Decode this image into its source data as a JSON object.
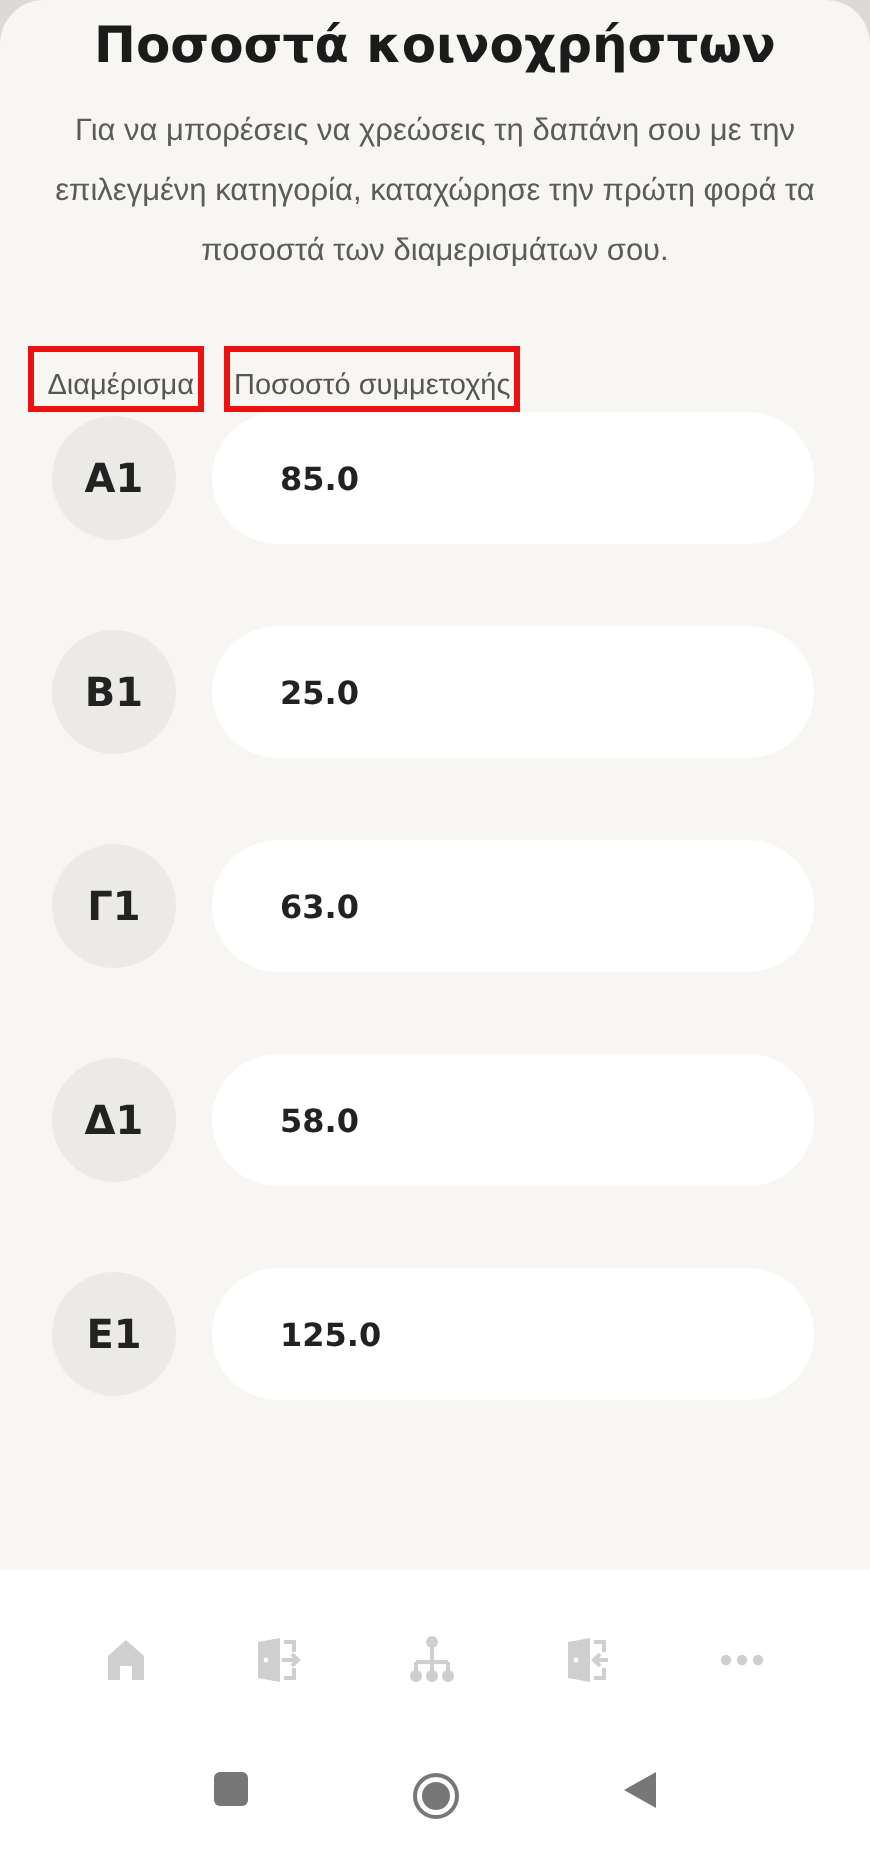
{
  "title": "Ποσοστά κοινοχρήστων",
  "description": "Για να μπορέσεις να χρεώσεις τη δαπάνη σου με την επιλεγμένη κατηγορία, καταχώρησε την πρώτη φορά τα ποσοστά των διαμερισμάτων σου.",
  "columns": [
    {
      "label": "Διαμέρισμα",
      "highlighted": true
    },
    {
      "label": "Ποσοστό συμμετοχής",
      "highlighted": true
    }
  ],
  "rows": [
    {
      "apartment": "Α1",
      "value": "85.0"
    },
    {
      "apartment": "Β1",
      "value": "25.0"
    },
    {
      "apartment": "Γ1",
      "value": "63.0"
    },
    {
      "apartment": "Δ1",
      "value": "58.0"
    },
    {
      "apartment": "Ε1",
      "value": "125.0"
    }
  ],
  "bottom_nav": [
    {
      "kind": "home"
    },
    {
      "kind": "exit"
    },
    {
      "kind": "tree"
    },
    {
      "kind": "enter"
    },
    {
      "kind": "more"
    }
  ],
  "system_nav": [
    {
      "kind": "recents"
    },
    {
      "kind": "home"
    },
    {
      "kind": "back"
    }
  ]
}
